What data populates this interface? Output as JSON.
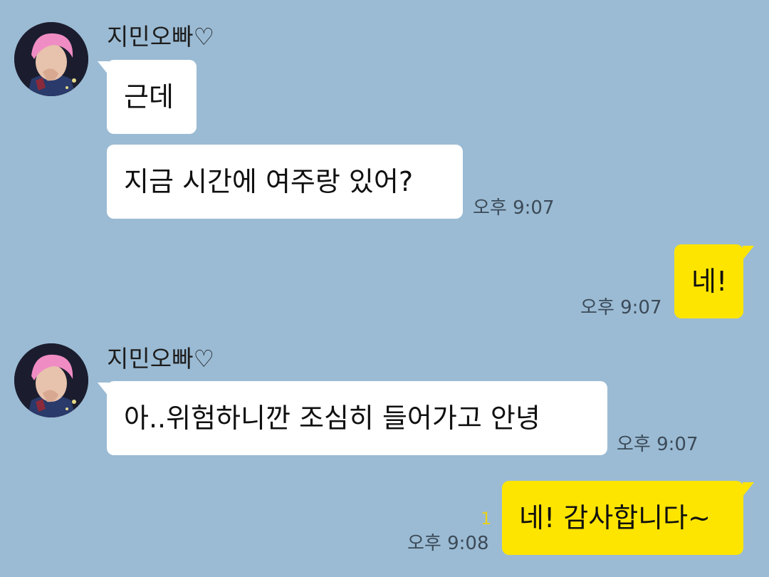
{
  "colors": {
    "background": "#9bbbd4",
    "incoming_bubble": "#ffffff",
    "outgoing_bubble": "#fee500",
    "timestamp": "#3c4a58",
    "unread_count": "#e8d21a"
  },
  "groups": [
    {
      "sender": "지민오빠♡",
      "avatar_icon": "profile-photo",
      "messages": [
        "근데",
        "지금 시간에 여주랑 있어?"
      ],
      "time": "오후 9:07"
    },
    {
      "direction": "outgoing",
      "messages": [
        "네!"
      ],
      "time": "오후 9:07"
    },
    {
      "sender": "지민오빠♡",
      "avatar_icon": "profile-photo",
      "messages": [
        "아..위험하니깐 조심히 들어가고 안녕"
      ],
      "time": "오후 9:07"
    },
    {
      "direction": "outgoing",
      "messages": [
        "네! 감사합니다~"
      ],
      "unread": "1",
      "time": "오후 9:08"
    }
  ]
}
